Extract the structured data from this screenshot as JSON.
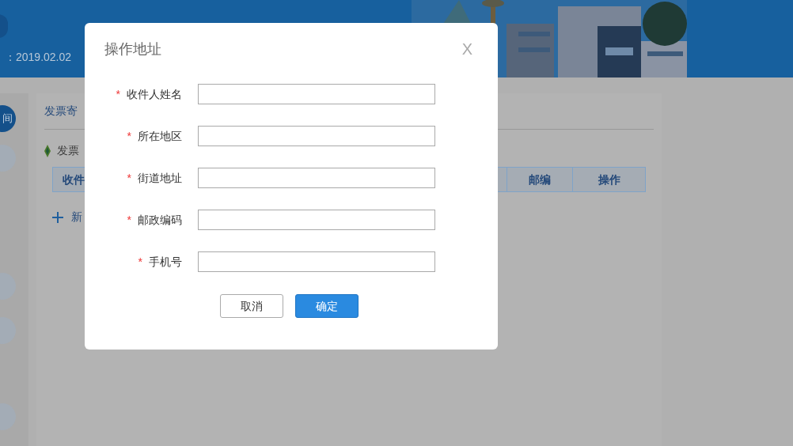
{
  "header": {
    "date": "：2019.02.02"
  },
  "sidebar": {
    "items": [
      {
        "label": "间",
        "selected": true
      },
      {
        "selected": false
      },
      {
        "selected": false
      },
      {
        "selected": false
      },
      {
        "selected": false
      }
    ]
  },
  "content": {
    "panel_title": "发票寄",
    "section_title": "发票",
    "table": {
      "columns": [
        "收件",
        "邮编",
        "操作"
      ]
    },
    "add_link": "新"
  },
  "dialog": {
    "title": "操作地址",
    "close": "X",
    "fields": [
      {
        "label": "收件人姓名",
        "marker": "*"
      },
      {
        "label": "所在地区",
        "marker": "*"
      },
      {
        "label": "街道地址",
        "marker": "*"
      },
      {
        "label": "邮政编码",
        "marker": "*"
      },
      {
        "label": "手机号",
        "marker": "*"
      }
    ],
    "buttons": [
      {
        "label": "取消",
        "kind": "secondary"
      },
      {
        "label": "确定",
        "kind": "primary"
      }
    ]
  }
}
